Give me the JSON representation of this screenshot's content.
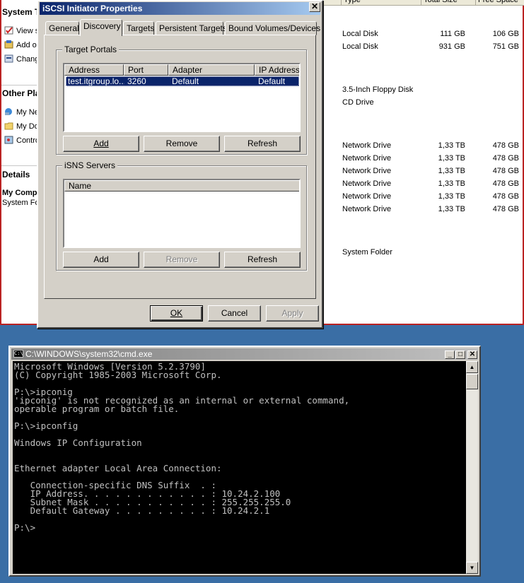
{
  "explorer": {
    "left_pane": {
      "system_tasks_title": "System T",
      "system_tasks": [
        {
          "label": "View s",
          "icon": "check-icon"
        },
        {
          "label": "Add o",
          "icon": "add-remove-icon"
        },
        {
          "label": "Chang",
          "icon": "settings-icon"
        }
      ],
      "other_places_title": "Other Pla",
      "other_places": [
        {
          "label": "My Ne",
          "icon": "network-icon"
        },
        {
          "label": "My Do",
          "icon": "folder-icon"
        },
        {
          "label": "Contro",
          "icon": "control-panel-icon"
        }
      ],
      "details_title": "Details",
      "details_name": "My Comp",
      "details_type": "System Fol"
    },
    "columns": {
      "type": "Type",
      "total_size": "Total Size",
      "free_space": "Free Space"
    },
    "rows": [
      {
        "type": "Local Disk",
        "total": "111 GB",
        "free": "106 GB"
      },
      {
        "type": "Local Disk",
        "total": "931 GB",
        "free": "751 GB"
      },
      {
        "type": "3.5-Inch Floppy Disk",
        "total": "",
        "free": ""
      },
      {
        "type": "CD Drive",
        "total": "",
        "free": ""
      },
      {
        "type": "Network Drive",
        "total": "1,33 TB",
        "free": "478 GB"
      },
      {
        "type": "Network Drive",
        "total": "1,33 TB",
        "free": "478 GB"
      },
      {
        "type": "Network Drive",
        "total": "1,33 TB",
        "free": "478 GB"
      },
      {
        "type": "Network Drive",
        "total": "1,33 TB",
        "free": "478 GB"
      },
      {
        "type": "Network Drive",
        "total": "1,33 TB",
        "free": "478 GB"
      },
      {
        "type": "Network Drive",
        "total": "1,33 TB",
        "free": "478 GB"
      },
      {
        "type": "System Folder",
        "total": "",
        "free": ""
      }
    ]
  },
  "iscsi": {
    "title": "iSCSI Initiator Properties",
    "close_glyph": "✕",
    "tabs": [
      "General",
      "Discovery",
      "Targets",
      "Persistent Targets",
      "Bound Volumes/Devices"
    ],
    "active_tab": "Discovery",
    "target_portals": {
      "label": "Target Portals",
      "columns": [
        "Address",
        "Port",
        "Adapter",
        "IP Address"
      ],
      "rows": [
        {
          "address": "test.itgroup.lo...",
          "port": "3260",
          "adapter": "Default",
          "ip": "Default"
        }
      ],
      "buttons": {
        "add": "Add",
        "remove": "Remove",
        "refresh": "Refresh"
      }
    },
    "isns_servers": {
      "label": "iSNS Servers",
      "columns": [
        "Name"
      ],
      "buttons": {
        "add": "Add",
        "remove": "Remove",
        "refresh": "Refresh"
      }
    },
    "footer": {
      "ok": "OK",
      "cancel": "Cancel",
      "apply": "Apply"
    }
  },
  "cmd": {
    "title": "C:\\WINDOWS\\system32\\cmd.exe",
    "icon_text": "C:\\",
    "controls": {
      "minimize": "_",
      "maximize": "□",
      "close": "✕"
    },
    "lines": [
      "Microsoft Windows [Version 5.2.3790]",
      "(C) Copyright 1985-2003 Microsoft Corp.",
      "",
      "P:\\>ipconig",
      "'ipconig' is not recognized as an internal or external command,",
      "operable program or batch file.",
      "",
      "P:\\>ipconfig",
      "",
      "Windows IP Configuration",
      "",
      "",
      "Ethernet adapter Local Area Connection:",
      "",
      "   Connection-specific DNS Suffix  . :",
      "   IP Address. . . . . . . . . . . . : 10.24.2.100",
      "   Subnet Mask . . . . . . . . . . . : 255.255.255.0",
      "   Default Gateway . . . . . . . . . : 10.24.2.1",
      "",
      "P:\\>"
    ],
    "scroll_up": "▲",
    "scroll_down": "▼"
  }
}
